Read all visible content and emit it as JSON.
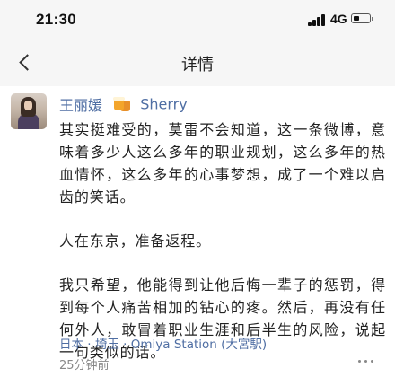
{
  "status_bar": {
    "time": "21:30",
    "network": "4G",
    "signal_icon": "signal-bars-icon",
    "battery_icon": "battery-low-icon"
  },
  "nav": {
    "back_icon": "chevron-left-icon",
    "title": "详情"
  },
  "post": {
    "username": "王丽媛",
    "badge_icon": "beer-cup-icon",
    "group_label": "Sherry",
    "paragraphs": [
      "其实挺难受的，莫雷不会知道，这一条微博，意味着多少人这么多年的职业规划，这么多年的热血情怀，这么多年的心事梦想，成了一个难以启齿的笑话。",
      "人在东京，准备返程。",
      "我只希望，他能得到让他后悔一辈子的惩罚，得到每个人痛苦相加的钻心的疼。然后，再没有任何外人，敢冒着职业生涯和后半生的风险，说起一句类似的话。"
    ],
    "location": "日本 · 埼玉 · Ōmiya Station (大宮駅)",
    "time_ago": "25分钟前",
    "more_icon": "more-dots-icon"
  },
  "colors": {
    "link": "#4f6ea3",
    "background": "#f6f6f6",
    "card": "#ffffff",
    "secondary_text": "#888888"
  }
}
